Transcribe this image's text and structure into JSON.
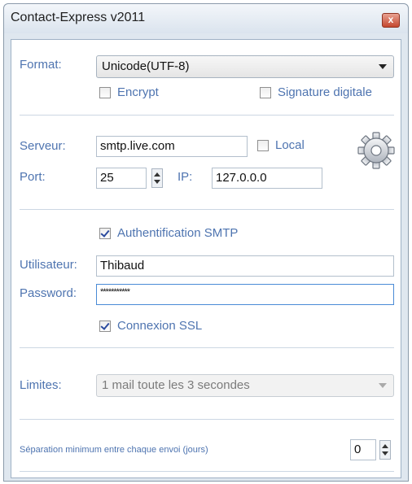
{
  "window": {
    "title": "Contact-Express v2011",
    "close": "x"
  },
  "format": {
    "label": "Format:",
    "value": "Unicode(UTF-8)",
    "encrypt": {
      "label": "Encrypt",
      "checked": false
    },
    "signature": {
      "label": "Signature digitale",
      "checked": false
    }
  },
  "server": {
    "server_label": "Serveur:",
    "server_value": "smtp.live.com",
    "local": {
      "label": "Local",
      "checked": false
    },
    "port_label": "Port:",
    "port_value": "25",
    "ip_label": "IP:",
    "ip_value": "127.0.0.0",
    "icon": "gear-icon"
  },
  "auth": {
    "smtp": {
      "label": "Authentification SMTP",
      "checked": true
    },
    "user_label": "Utilisateur:",
    "user_value": "Thibaud",
    "password_label": "Password:",
    "password_value": "***********",
    "ssl": {
      "label": "Connexion SSL",
      "checked": true
    }
  },
  "limits": {
    "label": "Limites:",
    "value": "1 mail toute les 3 secondes"
  },
  "separation": {
    "label": "Séparation minimum entre chaque envoi (jours)",
    "value": "0"
  }
}
